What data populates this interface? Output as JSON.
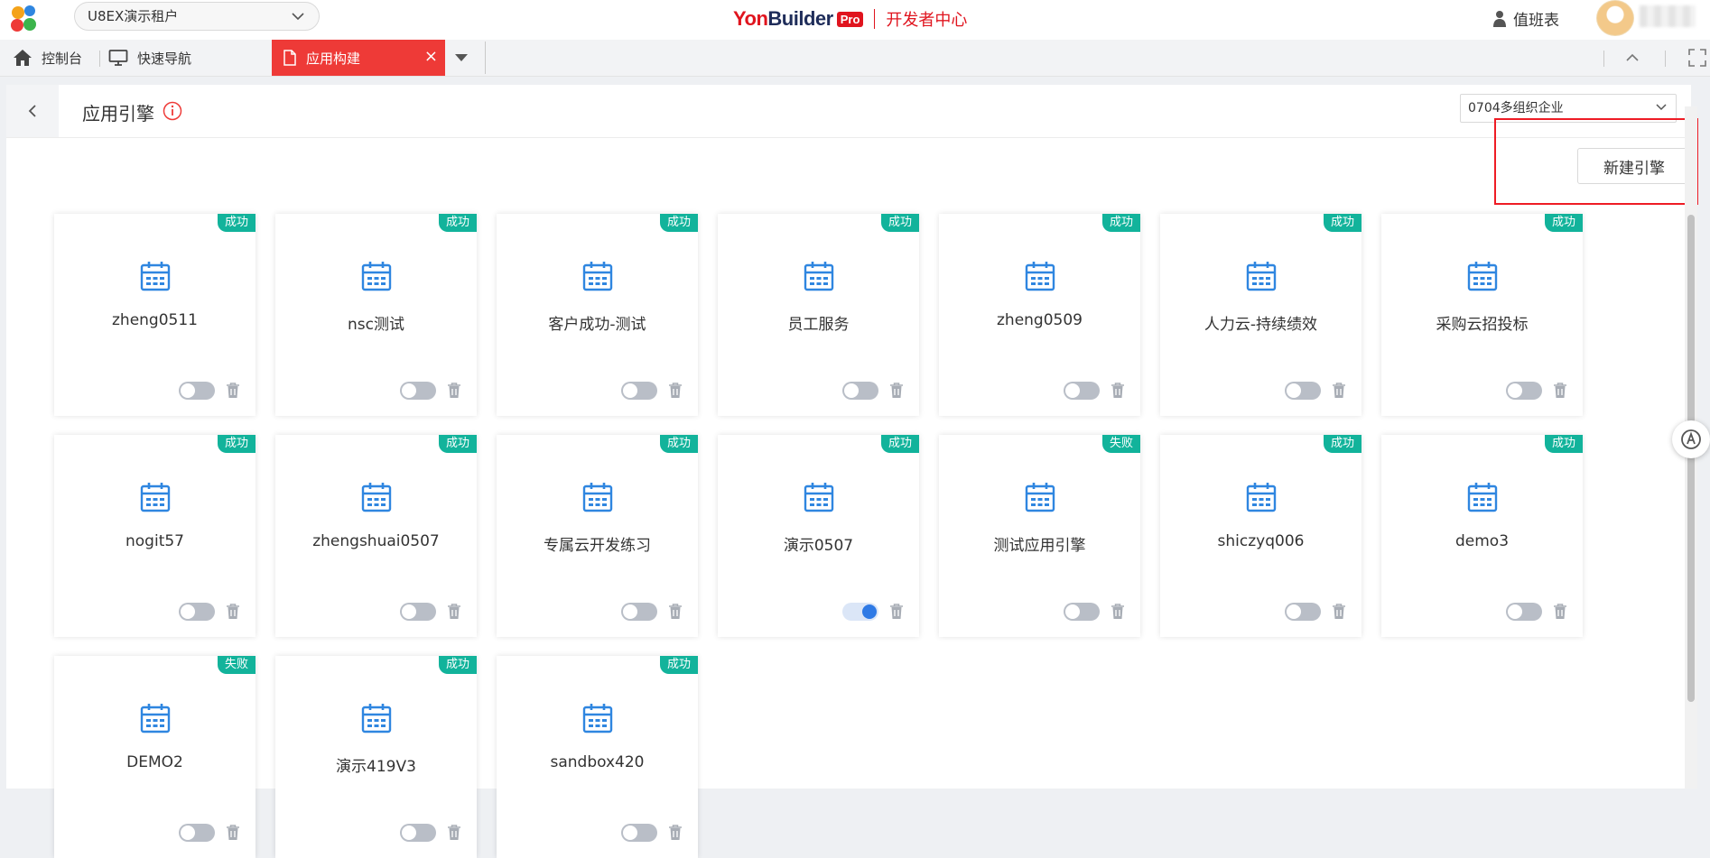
{
  "topbar": {
    "tenant": "U8EX演示租户",
    "brand_yon": "Yon",
    "brand_builder": "Builder",
    "brand_pro": "Pro",
    "brand_dev": "开发者中心",
    "duty": "值班表"
  },
  "tabbar": {
    "console": "控制台",
    "quick_nav": "快速导航",
    "active_tab": "应用构建"
  },
  "page": {
    "title": "应用引擎",
    "org_select": "0704多组织企业",
    "new_button": "新建引擎"
  },
  "colors": {
    "accent": "#ee3a37",
    "success": "#12b39b",
    "icon_blue": "#2f86e0"
  },
  "cards": [
    {
      "name": "zheng0511",
      "status": "成功",
      "enabled": false
    },
    {
      "name": "nsc测试",
      "status": "成功",
      "enabled": false
    },
    {
      "name": "客户成功-测试",
      "status": "成功",
      "enabled": false
    },
    {
      "name": "员工服务",
      "status": "成功",
      "enabled": false
    },
    {
      "name": "zheng0509",
      "status": "成功",
      "enabled": false
    },
    {
      "name": "人力云-持续绩效",
      "status": "成功",
      "enabled": false
    },
    {
      "name": "采购云招投标",
      "status": "成功",
      "enabled": false
    },
    {
      "name": "nogit57",
      "status": "成功",
      "enabled": false
    },
    {
      "name": "zhengshuai0507",
      "status": "成功",
      "enabled": false
    },
    {
      "name": "专属云开发练习",
      "status": "成功",
      "enabled": false
    },
    {
      "name": "演示0507",
      "status": "成功",
      "enabled": true
    },
    {
      "name": "测试应用引擎",
      "status": "失败",
      "enabled": false
    },
    {
      "name": "shiczyq006",
      "status": "成功",
      "enabled": false
    },
    {
      "name": "demo3",
      "status": "成功",
      "enabled": false
    },
    {
      "name": "DEMO2",
      "status": "失败",
      "enabled": false
    },
    {
      "name": "演示419V3",
      "status": "成功",
      "enabled": false
    },
    {
      "name": "sandbox420",
      "status": "成功",
      "enabled": false
    }
  ]
}
